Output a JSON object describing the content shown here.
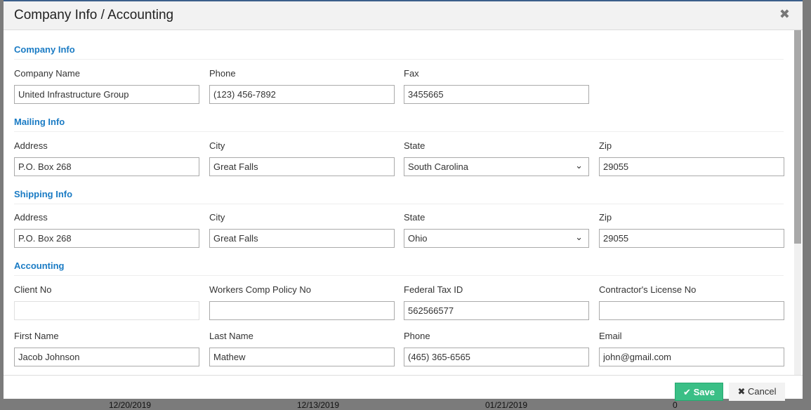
{
  "background": {
    "dates": [
      "12/20/2019",
      "12/13/2019",
      "01/21/2019",
      "0"
    ]
  },
  "modal": {
    "title": "Company Info / Accounting",
    "close_icon": "close-icon"
  },
  "sections": {
    "company": {
      "title": "Company Info",
      "company_name_label": "Company Name",
      "company_name": "United Infrastructure Group",
      "phone_label": "Phone",
      "phone": "(123) 456-7892",
      "fax_label": "Fax",
      "fax": "3455665"
    },
    "mailing": {
      "title": "Mailing Info",
      "address_label": "Address",
      "address": "P.O. Box 268",
      "city_label": "City",
      "city": "Great Falls",
      "state_label": "State",
      "state": "South Carolina",
      "zip_label": "Zip",
      "zip": "29055"
    },
    "shipping": {
      "title": "Shipping Info",
      "address_label": "Address",
      "address": "P.O. Box 268",
      "city_label": "City",
      "city": "Great Falls",
      "state_label": "State",
      "state": "Ohio",
      "zip_label": "Zip",
      "zip": "29055"
    },
    "accounting": {
      "title": "Accounting",
      "client_no_label": "Client No",
      "client_no": "",
      "workers_comp_label": "Workers Comp Policy No",
      "workers_comp": "",
      "federal_tax_label": "Federal Tax ID",
      "federal_tax": "562566577",
      "license_label": "Contractor's License No",
      "license": "",
      "first_name_label": "First Name",
      "first_name": "Jacob Johnson",
      "last_name_label": "Last Name",
      "last_name": "Mathew",
      "phone_label": "Phone",
      "phone": "(465) 365-6565",
      "email_label": "Email",
      "email": "john@gmail.com"
    }
  },
  "footer": {
    "save_label": "Save",
    "cancel_label": "Cancel"
  },
  "colors": {
    "accent": "#1a7bc4",
    "save": "#3abf86"
  }
}
